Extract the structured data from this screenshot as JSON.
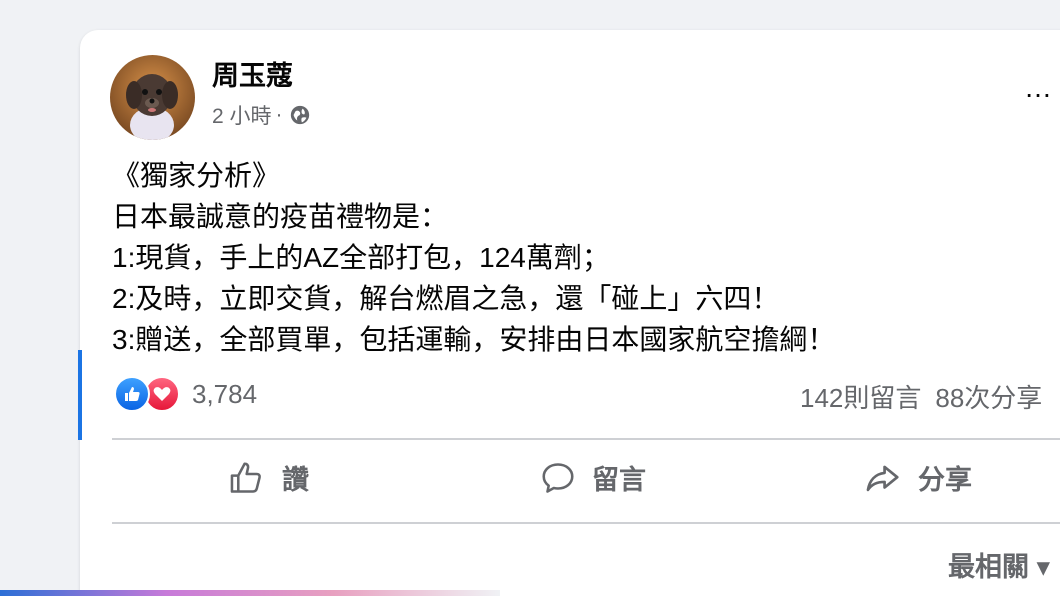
{
  "post": {
    "author": "周玉蔻",
    "time": "2 小時",
    "dot": "·",
    "more_icon": "…",
    "lines": [
      "《獨家分析》",
      "日本最誠意的疫苗禮物是：",
      "1:現貨，手上的AZ全部打包，124萬劑；",
      "2:及時，立即交貨，解台燃眉之急，還「碰上」六四！",
      "3:贈送，全部買單，包括運輸，安排由日本國家航空擔綱！"
    ]
  },
  "reactions": {
    "count": "3,784",
    "icons": [
      "like-icon",
      "love-icon"
    ],
    "colors": {
      "like": "#1b74e4",
      "love": "#f33e58"
    }
  },
  "stats": {
    "comments": "142則留言",
    "shares": "88次分享"
  },
  "actions": {
    "like": "讚",
    "comment": "留言",
    "share": "分享"
  },
  "sort": {
    "label": "最相關",
    "icon": "▾"
  },
  "colors": {
    "accent": "#1b74e4",
    "muted": "#65676b",
    "text": "#050505",
    "background": "#f0f2f5"
  }
}
